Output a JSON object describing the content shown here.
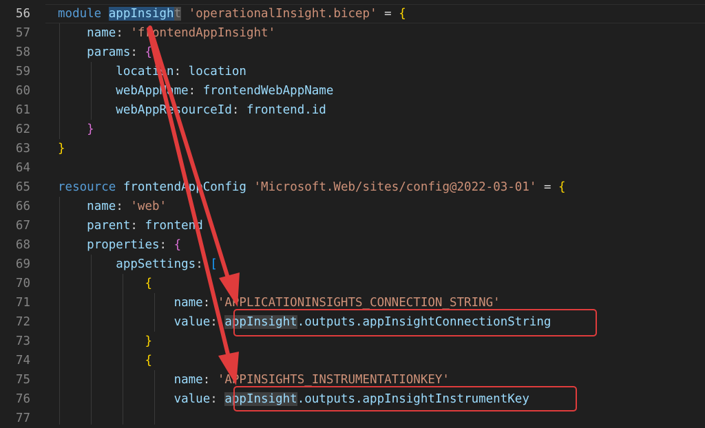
{
  "editor": {
    "line_numbers": [
      "56",
      "57",
      "58",
      "59",
      "60",
      "61",
      "62",
      "63",
      "64",
      "65",
      "66",
      "67",
      "68",
      "69",
      "70",
      "71",
      "72",
      "73",
      "74",
      "75",
      "76",
      "77"
    ],
    "lines": {
      "l56": {
        "kw": "module",
        "name": "appInsigh",
        "cursor_char": "t",
        "path": "'operationalInsight.bicep'",
        "eq": " = ",
        "brace": "{"
      },
      "l57": {
        "key": "name",
        "colon": ": ",
        "val": "'frontendAppInsight'"
      },
      "l58": {
        "key": "params",
        "colon": ": ",
        "brace": "{"
      },
      "l59": {
        "key": "location",
        "colon": ": ",
        "val": "location"
      },
      "l60": {
        "key": "webAppName",
        "colon": ": ",
        "val": "frontendWebAppName"
      },
      "l61": {
        "key": "webAppResourceId",
        "colon": ": ",
        "val": "frontend.id"
      },
      "l62": {
        "brace": "}"
      },
      "l63": {
        "brace": "}"
      },
      "l65": {
        "kw": "resource",
        "name": "frontendAppConfig",
        "path": "'Microsoft.Web/sites/config@2022-03-01'",
        "eq": " = ",
        "brace": "{"
      },
      "l66": {
        "key": "name",
        "colon": ": ",
        "val": "'web'"
      },
      "l67": {
        "key": "parent",
        "colon": ": ",
        "val": "frontend"
      },
      "l68": {
        "key": "properties",
        "colon": ": ",
        "brace": "{"
      },
      "l69": {
        "key": "appSettings",
        "colon": ": ",
        "brace": "["
      },
      "l70": {
        "brace": "{"
      },
      "l71": {
        "key": "name",
        "colon": ": ",
        "val": "'APPLICATIONINSIGHTS_CONNECTION_STRING'"
      },
      "l72": {
        "key": "value",
        "colon": ": ",
        "ref": "appInsight",
        "rest": ".outputs.appInsightConnectionString"
      },
      "l73": {
        "brace": "}"
      },
      "l74": {
        "brace": "{"
      },
      "l75": {
        "key": "name",
        "colon": ": ",
        "val": "'APPINSIGHTS_INSTRUMENTATIONKEY'"
      },
      "l76": {
        "key": "value",
        "colon": ": ",
        "ref": "appInsight",
        "rest": ".outputs.appInsightInstrumentKey"
      }
    }
  },
  "colors": {
    "background": "#1f1f1f",
    "keyword": "#569cd6",
    "identifier": "#9cdcfe",
    "string": "#ce9178",
    "bracket_gold": "#ffd700",
    "bracket_purple": "#da70d6",
    "bracket_blue": "#179fff",
    "annotation_red": "#e03c3c"
  },
  "annotations": {
    "arrows": [
      "arrow-to-connection-string",
      "arrow-to-instrument-key"
    ],
    "boxes": [
      "box-connection-string",
      "box-instrument-key"
    ]
  }
}
